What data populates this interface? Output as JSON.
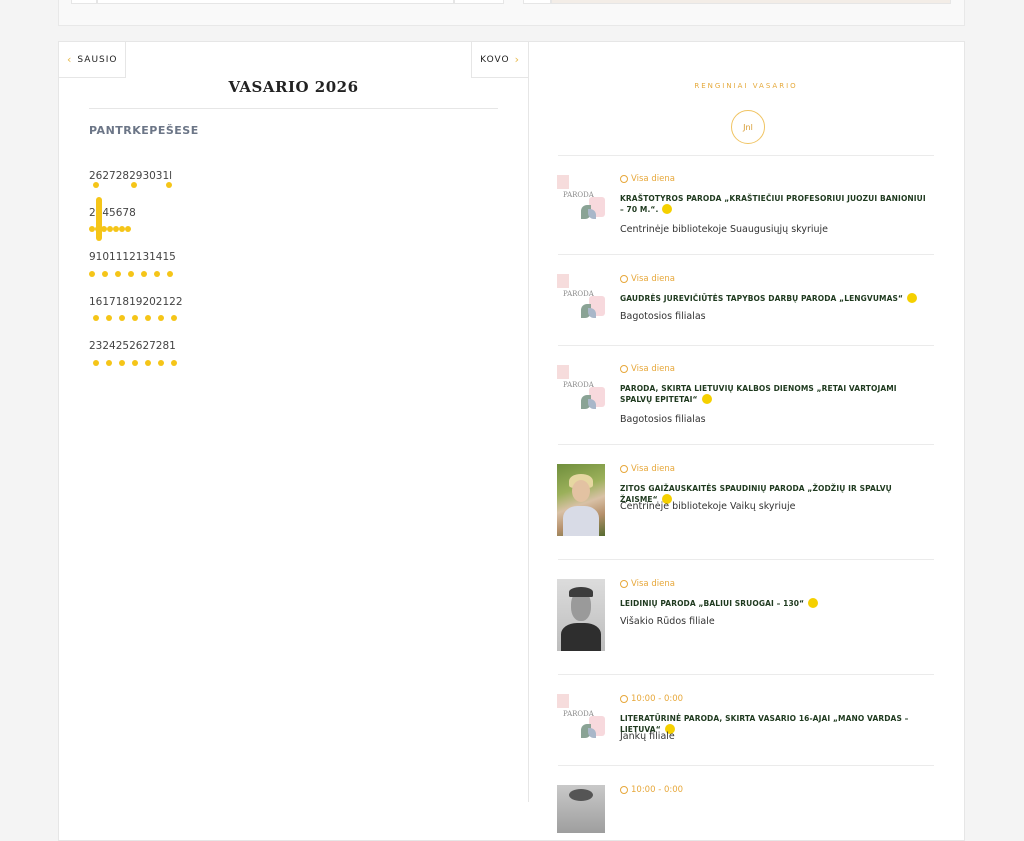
{
  "calendar": {
    "prev_label": "SAUSIO",
    "next_label": "KOVO",
    "month_title": "VASARIO 2026",
    "weekdays": "PANTRKEPEŠESE",
    "weeks": [
      "262728293031l",
      "2345678",
      "9101112131415",
      "16171819202122",
      "2324252627281"
    ]
  },
  "events_panel": {
    "heading": "RENGINIAI VASARIO",
    "circle_label": "Jnl",
    "events": [
      {
        "time": "Visa diena",
        "title": "KRAŠTOTYROS PARODA „KRAŠTIEČIUI PROFESORIUI JUOZUI BANIONIUI – 70 M.“.",
        "place": "Centrinėje bibliotekoje Suaugusiųjų skyriuje",
        "thumb_text": "PARODA"
      },
      {
        "time": "Visa diena",
        "title": "GAUDRĖS JUREVIČIŪTĖS TAPYBOS DARBŲ PARODA „LENGVUMAS“",
        "place": "Bagotosios filialas",
        "thumb_text": "PARODA"
      },
      {
        "time": "Visa diena",
        "title": "PARODA, SKIRTA LIETUVIŲ KALBOS DIENOMS „RETAI VARTOJAMI SPALVŲ EPITETAI“",
        "place": "Bagotosios filialas",
        "thumb_text": "PARODA"
      },
      {
        "time": "Visa diena",
        "title": "ZITOS GAIŽAUSKAITĖS SPAUDINIŲ PARODA „ŽODŽIŲ IR SPALVŲ ŽAISME“",
        "place": "Centrinėje bibliotekoje Vaikų skyriuje"
      },
      {
        "time": "Visa diena",
        "title": "LEIDINIŲ PARODA „BALIUI SRUOGAI – 130“",
        "place": "Višakio Rūdos filiale"
      },
      {
        "time": "10:00 - 0:00",
        "title": "LITERATŪRINĖ PARODA, SKIRTA VASARIO 16-AJAI „MANO VARDAS – LIETUVA“",
        "place": "Jankų filiale",
        "thumb_text": "PARODA"
      },
      {
        "time": "10:00 - 0:00"
      }
    ]
  }
}
